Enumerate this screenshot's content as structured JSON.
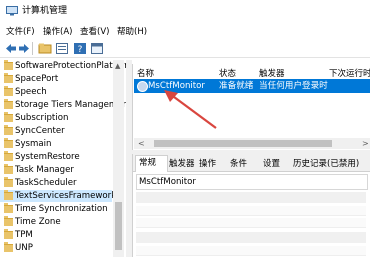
{
  "window": {
    "title": "计算机管理"
  },
  "menu": [
    {
      "label": "文件(F)"
    },
    {
      "label": "操作(A)"
    },
    {
      "label": "查看(V)"
    },
    {
      "label": "帮助(H)"
    }
  ],
  "toolbar": {
    "icons": [
      "back-arrow-icon",
      "forward-arrow-icon",
      "folder-up-icon",
      "properties-icon",
      "help-icon",
      "panel-icon"
    ]
  },
  "tree": {
    "items": [
      {
        "label": "SoftwareProtectionPlatform",
        "selected": false
      },
      {
        "label": "SpacePort",
        "selected": false
      },
      {
        "label": "Speech",
        "selected": false
      },
      {
        "label": "Storage Tiers Management",
        "selected": false
      },
      {
        "label": "Subscription",
        "selected": false
      },
      {
        "label": "SyncCenter",
        "selected": false
      },
      {
        "label": "Sysmain",
        "selected": false
      },
      {
        "label": "SystemRestore",
        "selected": false
      },
      {
        "label": "Task Manager",
        "selected": false
      },
      {
        "label": "TaskScheduler",
        "selected": false
      },
      {
        "label": "TextServicesFramework",
        "selected": true
      },
      {
        "label": "Time Synchronization",
        "selected": false
      },
      {
        "label": "Time Zone",
        "selected": false
      },
      {
        "label": "TPM",
        "selected": false
      },
      {
        "label": "UNP",
        "selected": false
      }
    ]
  },
  "task_list": {
    "columns": [
      {
        "label": "名称"
      },
      {
        "label": "状态"
      },
      {
        "label": "触发器"
      },
      {
        "label": "下次运行时间"
      }
    ],
    "rows": [
      {
        "name": "MsCtfMonitor",
        "status": "准备就绪",
        "trigger": "当任何用户登录时",
        "next_run": ""
      }
    ]
  },
  "details": {
    "tabs": [
      {
        "label": "常规",
        "active": true
      },
      {
        "label": "触发器",
        "active": false
      },
      {
        "label": "操作",
        "active": false
      },
      {
        "label": "条件",
        "active": false
      },
      {
        "label": "设置",
        "active": false
      },
      {
        "label": "历史记录(已禁用)",
        "active": false
      }
    ],
    "name_value": "MsCtfMonitor"
  },
  "colors": {
    "selection": "#0078d7",
    "tree_selection": "#cce8ff",
    "annotation_arrow": "#d9463f"
  }
}
